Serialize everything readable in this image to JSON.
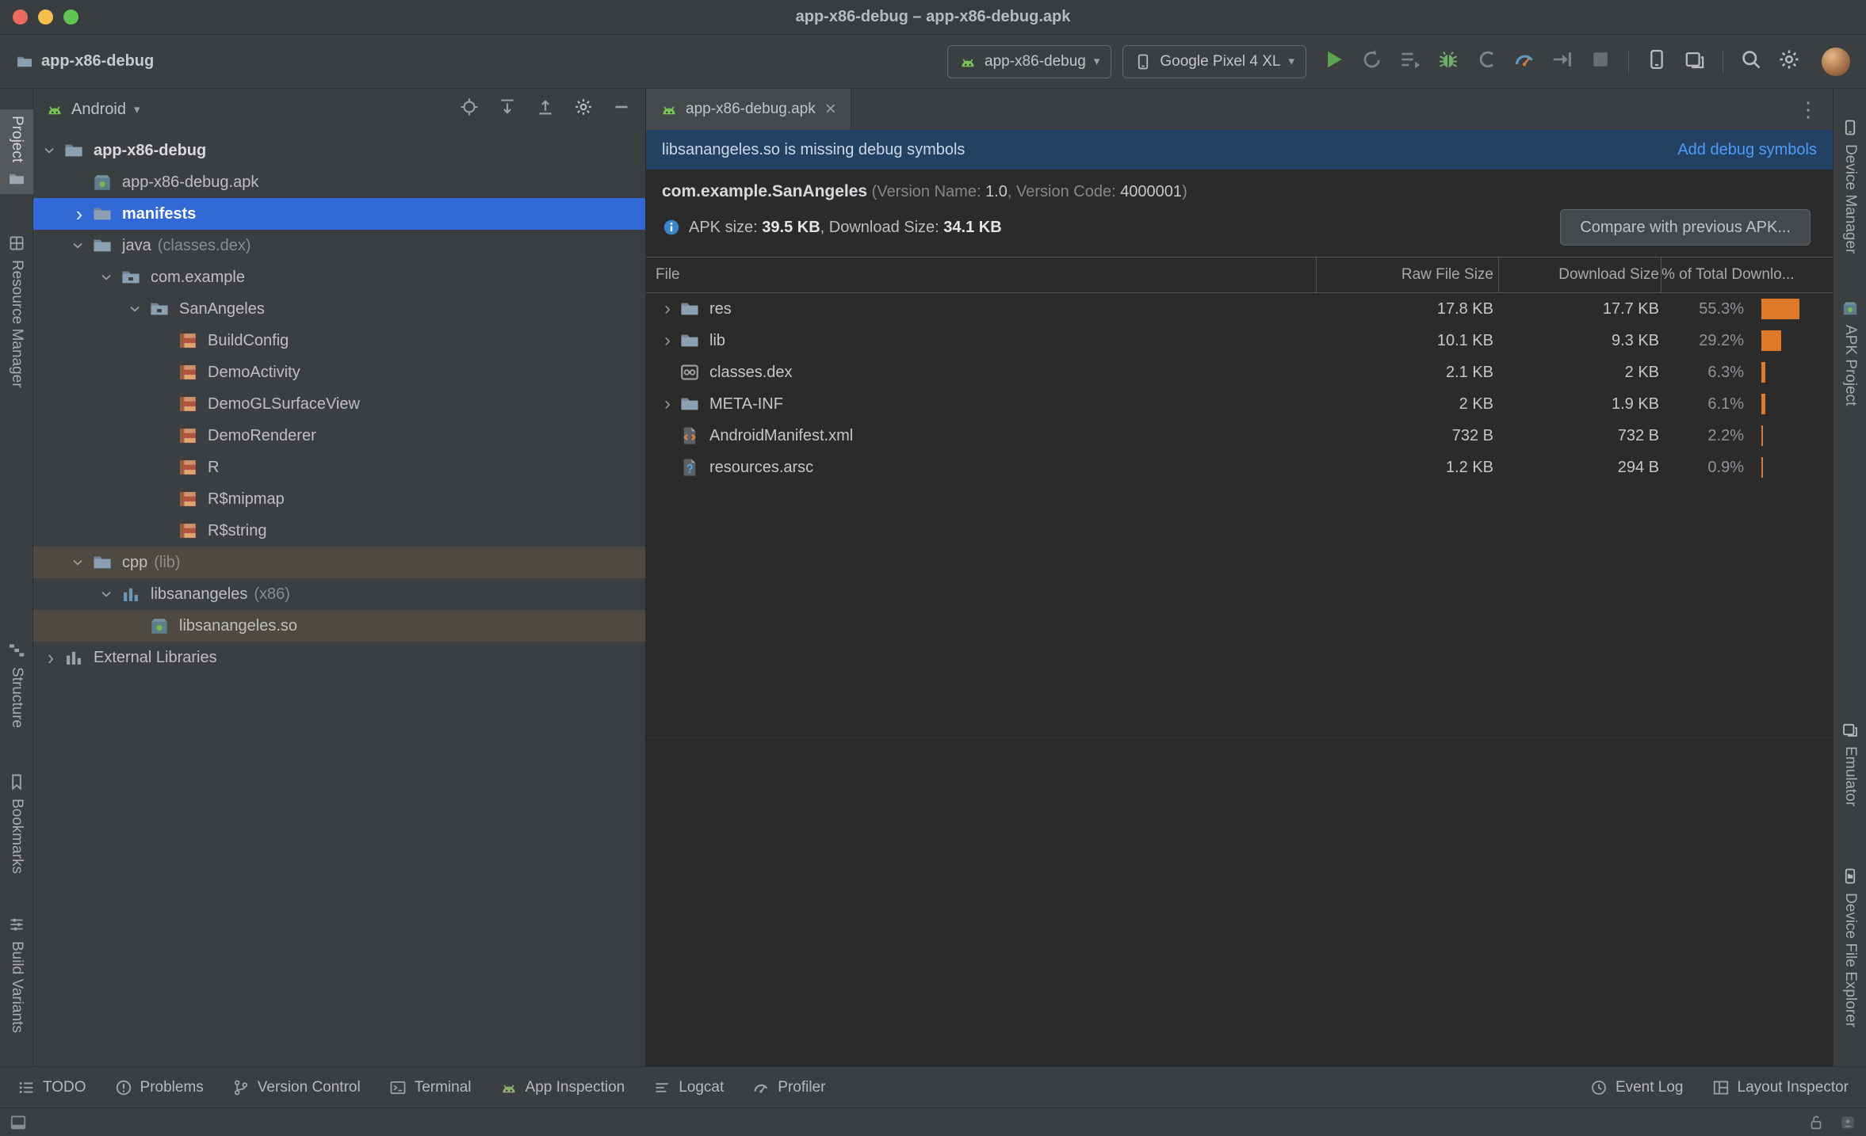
{
  "window": {
    "title": "app-x86-debug – app-x86-debug.apk"
  },
  "icons": {
    "caret_down": "▾",
    "close": "×",
    "more": "⋮",
    "chevron": "›"
  },
  "toolbar": {
    "project": "app-x86-debug",
    "run_config": "app-x86-debug",
    "device": "Google Pixel 4 XL",
    "run_actions": [
      "run",
      "rerun",
      "run-configurations",
      "debug",
      "coverage",
      "profiler",
      "attach-debugger",
      "stop"
    ],
    "device_actions": [
      "device-manager",
      "virtual-devices"
    ],
    "global_actions": [
      "search",
      "settings"
    ]
  },
  "left_strip": [
    {
      "label": "Project",
      "icon": "project"
    },
    {
      "label": "Resource Manager",
      "icon": "resource-manager"
    },
    {
      "label": "Structure",
      "icon": "structure"
    },
    {
      "label": "Bookmarks",
      "icon": "bookmarks"
    },
    {
      "label": "Build Variants",
      "icon": "build-variants"
    }
  ],
  "right_strip": [
    {
      "label": "Device Manager",
      "icon": "device-manager"
    },
    {
      "label": "APK Project",
      "icon": "apk"
    },
    {
      "label": "Emulator",
      "icon": "virtual-devices"
    },
    {
      "label": "Device File Explorer",
      "icon": "device-file-explorer"
    }
  ],
  "project_panel": {
    "mode": "Android",
    "actions": [
      "locate",
      "expand-all",
      "collapse-all",
      "settings",
      "hide"
    ],
    "tree": [
      {
        "label": "app-x86-debug",
        "level": 0,
        "arrow": "down",
        "icon": "folder",
        "bold": true
      },
      {
        "label": "app-x86-debug.apk",
        "level": 1,
        "arrow": "none",
        "icon": "apk"
      },
      {
        "label": "manifests",
        "level": 1,
        "arrow": "right",
        "icon": "folder",
        "bold": true,
        "highlight": "selected"
      },
      {
        "label": "java",
        "suffix": " (classes.dex)",
        "level": 1,
        "arrow": "down",
        "icon": "folder"
      },
      {
        "label": "com.example",
        "level": 2,
        "arrow": "down",
        "icon": "package"
      },
      {
        "label": "SanAngeles",
        "level": 3,
        "arrow": "down",
        "icon": "package"
      },
      {
        "label": "BuildConfig",
        "level": 4,
        "arrow": "none",
        "icon": "class"
      },
      {
        "label": "DemoActivity",
        "level": 4,
        "arrow": "none",
        "icon": "class"
      },
      {
        "label": "DemoGLSurfaceView",
        "level": 4,
        "arrow": "none",
        "icon": "class"
      },
      {
        "label": "DemoRenderer",
        "level": 4,
        "arrow": "none",
        "icon": "class"
      },
      {
        "label": "R",
        "level": 4,
        "arrow": "none",
        "icon": "class"
      },
      {
        "label": "R$mipmap",
        "level": 4,
        "arrow": "none",
        "icon": "class"
      },
      {
        "label": "R$string",
        "level": 4,
        "arrow": "none",
        "icon": "class"
      },
      {
        "label": "cpp",
        "suffix": " (lib)",
        "level": 1,
        "arrow": "down",
        "icon": "folder",
        "highlight": "inactive"
      },
      {
        "label": "libsanangeles",
        "suffix": " (x86)",
        "level": 2,
        "arrow": "down",
        "icon": "library"
      },
      {
        "label": "libsanangeles.so",
        "level": 3,
        "arrow": "none",
        "icon": "so",
        "highlight": "inactive"
      },
      {
        "label": "External Libraries",
        "level": 0,
        "arrow": "right",
        "icon": "libraries"
      }
    ]
  },
  "editor": {
    "tab": "app-x86-debug.apk",
    "banner": {
      "message": "libsanangeles.so is missing debug symbols",
      "action": "Add debug symbols"
    },
    "apk_header": {
      "name": "com.example.SanAngeles",
      "meta_pre": " (Version Name: ",
      "version_name": "1.0",
      "meta_mid": ", Version Code: ",
      "version_code": "4000001",
      "meta_post": ")"
    },
    "size_line": {
      "label1": "APK size: ",
      "apk_size": "39.5 KB",
      "label2": ", Download Size: ",
      "download_size": "34.1 KB"
    },
    "compare_button": "Compare with previous APK...",
    "table": {
      "columns": {
        "file": "File",
        "raw": "Raw File Size",
        "download": "Download Size",
        "pct": "% of Total Downlo..."
      },
      "rows": [
        {
          "name": "res",
          "icon": "folder",
          "expandable": true,
          "raw": "17.8 KB",
          "download": "17.7 KB",
          "pct": "55.3%",
          "pct_value": 55.3
        },
        {
          "name": "lib",
          "icon": "folder",
          "expandable": true,
          "raw": "10.1 KB",
          "download": "9.3 KB",
          "pct": "29.2%",
          "pct_value": 29.2
        },
        {
          "name": "classes.dex",
          "icon": "dex",
          "expandable": false,
          "raw": "2.1 KB",
          "download": "2 KB",
          "pct": "6.3%",
          "pct_value": 6.3
        },
        {
          "name": "META-INF",
          "icon": "folder",
          "expandable": true,
          "raw": "2 KB",
          "download": "1.9 KB",
          "pct": "6.1%",
          "pct_value": 6.1
        },
        {
          "name": "AndroidManifest.xml",
          "icon": "xml",
          "expandable": false,
          "raw": "732 B",
          "download": "732 B",
          "pct": "2.2%",
          "pct_value": 2.2
        },
        {
          "name": "resources.arsc",
          "icon": "arsc",
          "expandable": false,
          "raw": "1.2 KB",
          "download": "294 B",
          "pct": "0.9%",
          "pct_value": 0.9
        }
      ]
    }
  },
  "bottom_bar": {
    "left": [
      {
        "label": "TODO",
        "icon": "todo"
      },
      {
        "label": "Problems",
        "icon": "problems"
      },
      {
        "label": "Version Control",
        "icon": "version-control"
      },
      {
        "label": "Terminal",
        "icon": "terminal"
      },
      {
        "label": "App Inspection",
        "icon": "app-inspection"
      },
      {
        "label": "Logcat",
        "icon": "logcat"
      },
      {
        "label": "Profiler",
        "icon": "profiler-gray"
      }
    ],
    "right": [
      {
        "label": "Event Log",
        "icon": "event-log"
      },
      {
        "label": "Layout Inspector",
        "icon": "layout-inspector"
      }
    ]
  },
  "colors": {
    "selection_blue": "#3369d6",
    "inactive_selection": "#4e4a41",
    "bar_orange": "#e0782a",
    "link_blue": "#4e9bfa",
    "run_green": "#5aa550"
  }
}
